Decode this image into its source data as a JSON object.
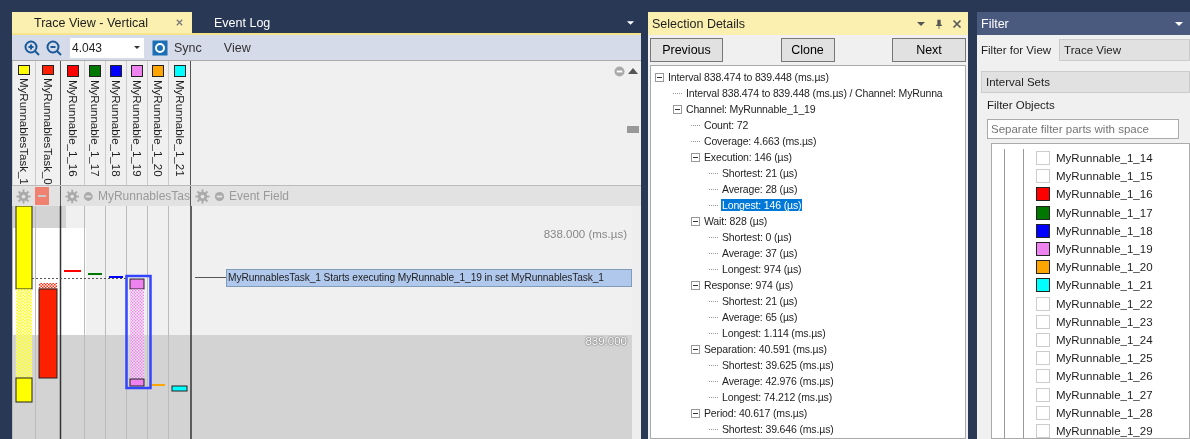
{
  "trace_view": {
    "tabs": [
      {
        "label": "Trace View - Vertical",
        "selected": true,
        "closable": true
      },
      {
        "label": "Event Log",
        "selected": false,
        "closable": false
      }
    ],
    "toolbar": {
      "zoom_value": "4.043",
      "sync_label": "Sync",
      "view_label": "View"
    },
    "groups": [
      {
        "channels": [
          {
            "name": "MyRunnablesTask_1",
            "color": "#ffff00"
          },
          {
            "name": "MyRunnablesTask_0",
            "color": "#ff2000"
          }
        ]
      },
      {
        "label": "MyRunnablesTas",
        "channels": [
          {
            "name": "MyRunnable_1_16",
            "color": "#ff0000"
          },
          {
            "name": "MyRunnable_1_17",
            "color": "#007800"
          },
          {
            "name": "MyRunnable_1_18",
            "color": "#0000ff"
          },
          {
            "name": "MyRunnable_1_19",
            "color": "#ee82ee"
          },
          {
            "name": "MyRunnable_1_20",
            "color": "#ffa500"
          },
          {
            "name": "MyRunnable_1_21",
            "color": "#00ffff"
          }
        ]
      },
      {
        "label": "Event Field"
      }
    ],
    "time_labels": [
      "838.000 (ms.µs)",
      "839.000"
    ],
    "tooltip": "MyRunnablesTask_1 Starts executing MyRunnable_1_19 in set MyRunnablesTask_1"
  },
  "selection_details": {
    "title": "Selection Details",
    "buttons": [
      "Previous",
      "Clone",
      "Next"
    ],
    "tree": [
      {
        "label": "Interval 838.474 to 839.448 (ms.µs)",
        "expanded": true,
        "selected": false,
        "children": [
          {
            "label": "Interval 838.474 to 839.448 (ms.µs) / Channel: MyRunna",
            "selected": false
          },
          {
            "label": "Channel: MyRunnable_1_19",
            "expanded": true,
            "selected": false,
            "children": [
              {
                "label": "Count: 72",
                "selected": false
              },
              {
                "label": "Coverage: 4.663 (ms.µs)",
                "selected": false
              },
              {
                "label": "Execution: 146 (µs)",
                "expanded": true,
                "selected": false,
                "children": [
                  {
                    "label": "Shortest: 21 (µs)",
                    "selected": false
                  },
                  {
                    "label": "Average: 28 (µs)",
                    "selected": false
                  },
                  {
                    "label": "Longest: 146 (µs)",
                    "selected": true
                  }
                ]
              },
              {
                "label": "Wait: 828 (µs)",
                "expanded": true,
                "selected": false,
                "children": [
                  {
                    "label": "Shortest: 0 (µs)",
                    "selected": false
                  },
                  {
                    "label": "Average: 37 (µs)",
                    "selected": false
                  },
                  {
                    "label": "Longest: 974 (µs)",
                    "selected": false
                  }
                ]
              },
              {
                "label": "Response: 974 (µs)",
                "expanded": true,
                "selected": false,
                "children": [
                  {
                    "label": "Shortest: 21 (µs)",
                    "selected": false
                  },
                  {
                    "label": "Average: 65 (µs)",
                    "selected": false
                  },
                  {
                    "label": "Longest: 1.114 (ms.µs)",
                    "selected": false
                  }
                ]
              },
              {
                "label": "Separation: 40.591 (ms.µs)",
                "expanded": true,
                "selected": false,
                "children": [
                  {
                    "label": "Shortest: 39.625 (ms.µs)",
                    "selected": false
                  },
                  {
                    "label": "Average: 42.976 (ms.µs)",
                    "selected": false
                  },
                  {
                    "label": "Longest: 74.212 (ms.µs)",
                    "selected": false
                  }
                ]
              },
              {
                "label": "Period: 40.617 (ms.µs)",
                "expanded": true,
                "selected": false,
                "children": [
                  {
                    "label": "Shortest: 39.646 (ms.µs)",
                    "selected": false
                  }
                ]
              }
            ]
          }
        ]
      }
    ]
  },
  "filter": {
    "title": "Filter",
    "view_label": "Filter for View",
    "view_value": "Trace View",
    "set_value": "Interval Sets",
    "group_label": "Filter Objects",
    "search": {
      "placeholder": "Separate filter parts with space"
    },
    "objects": [
      {
        "name": "MyRunnable_1_14",
        "checked": false
      },
      {
        "name": "MyRunnable_1_15",
        "checked": false
      },
      {
        "name": "MyRunnable_1_16",
        "checked": true,
        "color": "#ff0000"
      },
      {
        "name": "MyRunnable_1_17",
        "checked": true,
        "color": "#007800"
      },
      {
        "name": "MyRunnable_1_18",
        "checked": true,
        "color": "#0000ff"
      },
      {
        "name": "MyRunnable_1_19",
        "checked": true,
        "color": "#ee82ee"
      },
      {
        "name": "MyRunnable_1_20",
        "checked": true,
        "color": "#ffa500"
      },
      {
        "name": "MyRunnable_1_21",
        "checked": true,
        "color": "#00ffff"
      },
      {
        "name": "MyRunnable_1_22",
        "checked": false
      },
      {
        "name": "MyRunnable_1_23",
        "checked": false
      },
      {
        "name": "MyRunnable_1_24",
        "checked": false
      },
      {
        "name": "MyRunnable_1_25",
        "checked": false
      },
      {
        "name": "MyRunnable_1_26",
        "checked": false
      },
      {
        "name": "MyRunnable_1_27",
        "checked": false
      },
      {
        "name": "MyRunnable_1_28",
        "checked": false
      },
      {
        "name": "MyRunnable_1_29",
        "checked": false
      }
    ]
  }
}
